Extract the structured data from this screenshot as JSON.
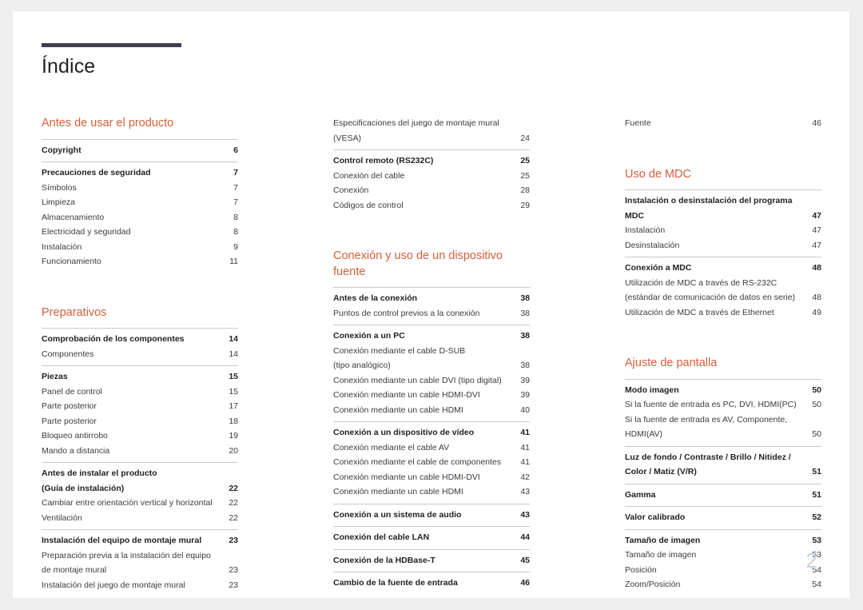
{
  "document": {
    "title": "Índice",
    "folio": "2",
    "accent_color": "#d2603c",
    "rule_color": "#403e4c",
    "folio_color": "#c3d3dd"
  },
  "columns": [
    {
      "name": "column-left",
      "blocks": [
        {
          "type": "section",
          "heading": "Antes de usar el producto",
          "groups": [
            {
              "entries": [
                {
                  "label": "Copyright",
                  "page": "6",
                  "bold": true
                }
              ]
            },
            {
              "entries": [
                {
                  "label": "Precauciones de seguridad",
                  "page": "7",
                  "bold": true
                },
                {
                  "label": "Símbolos",
                  "page": "7",
                  "bold": false
                },
                {
                  "label": "Limpieza",
                  "page": "7",
                  "bold": false
                },
                {
                  "label": "Almacenamiento",
                  "page": "8",
                  "bold": false
                },
                {
                  "label": "Electricidad y seguridad",
                  "page": "8",
                  "bold": false
                },
                {
                  "label": "Instalación",
                  "page": "9",
                  "bold": false
                },
                {
                  "label": "Funcionamiento",
                  "page": "11",
                  "bold": false
                }
              ]
            }
          ]
        },
        {
          "type": "section",
          "heading": "Preparativos",
          "groups": [
            {
              "entries": [
                {
                  "label": "Comprobación de los componentes",
                  "page": "14",
                  "bold": true
                },
                {
                  "label": "Componentes",
                  "page": "14",
                  "bold": false
                }
              ]
            },
            {
              "entries": [
                {
                  "label": "Piezas",
                  "page": "15",
                  "bold": true
                },
                {
                  "label": "Panel de control",
                  "page": "15",
                  "bold": false
                },
                {
                  "label": "Parte posterior",
                  "page": "17",
                  "bold": false
                },
                {
                  "label": "Parte posterior",
                  "page": "18",
                  "bold": false
                },
                {
                  "label": "Bloqueo antirrobo",
                  "page": "19",
                  "bold": false
                },
                {
                  "label": "Mando a distancia",
                  "page": "20",
                  "bold": false
                }
              ]
            },
            {
              "entries": [
                {
                  "label": "Antes de instalar el producto",
                  "page": "",
                  "bold": true,
                  "blank": true
                },
                {
                  "label": "(Guía de instalación)",
                  "page": "22",
                  "bold": true
                },
                {
                  "label": "Cambiar entre orientación vertical y horizontal",
                  "page": "22",
                  "bold": false
                },
                {
                  "label": "Ventilación",
                  "page": "22",
                  "bold": false
                }
              ]
            },
            {
              "entries": [
                {
                  "label": "Instalación del equipo de montaje mural",
                  "page": "23",
                  "bold": true
                },
                {
                  "label": "Preparación previa a la instalación del equipo",
                  "page": "",
                  "bold": false,
                  "blank": true
                },
                {
                  "label": "de montaje mural",
                  "page": "23",
                  "bold": false
                },
                {
                  "label": "Instalación del juego de montaje mural",
                  "page": "23",
                  "bold": false
                }
              ]
            }
          ]
        }
      ]
    },
    {
      "name": "column-middle",
      "blocks": [
        {
          "type": "continuation",
          "groups": [
            {
              "nohead": true,
              "entries": [
                {
                  "label": "Especificaciones del juego de montaje mural",
                  "page": "",
                  "bold": false,
                  "blank": true
                },
                {
                  "label": "(VESA)",
                  "page": "24",
                  "bold": false
                }
              ]
            },
            {
              "entries": [
                {
                  "label": "Control remoto (RS232C)",
                  "page": "25",
                  "bold": true
                },
                {
                  "label": "Conexión del cable",
                  "page": "25",
                  "bold": false
                },
                {
                  "label": "Conexión",
                  "page": "28",
                  "bold": false
                },
                {
                  "label": "Códigos de control",
                  "page": "29",
                  "bold": false
                }
              ]
            }
          ]
        },
        {
          "type": "section",
          "heading": "Conexión y uso de un dispositivo fuente",
          "groups": [
            {
              "entries": [
                {
                  "label": "Antes de la conexión",
                  "page": "38",
                  "bold": true
                },
                {
                  "label": "Puntos de control previos a la conexión",
                  "page": "38",
                  "bold": false
                }
              ]
            },
            {
              "entries": [
                {
                  "label": "Conexión a un PC",
                  "page": "38",
                  "bold": true
                },
                {
                  "label": "Conexión mediante el cable D-SUB",
                  "page": "",
                  "bold": false,
                  "blank": true
                },
                {
                  "label": "(tipo analógico)",
                  "page": "38",
                  "bold": false
                },
                {
                  "label": "Conexión mediante un cable DVI (tipo digital)",
                  "page": "39",
                  "bold": false
                },
                {
                  "label": "Conexión mediante un cable HDMI-DVI",
                  "page": "39",
                  "bold": false
                },
                {
                  "label": "Conexión mediante un cable HDMI",
                  "page": "40",
                  "bold": false
                }
              ]
            },
            {
              "entries": [
                {
                  "label": "Conexión a un dispositivo de vídeo",
                  "page": "41",
                  "bold": true
                },
                {
                  "label": "Conexión mediante el cable AV",
                  "page": "41",
                  "bold": false
                },
                {
                  "label": "Conexión mediante el cable de componentes",
                  "page": "41",
                  "bold": false
                },
                {
                  "label": "Conexión mediante un cable HDMI-DVI",
                  "page": "42",
                  "bold": false
                },
                {
                  "label": "Conexión mediante un cable HDMI",
                  "page": "43",
                  "bold": false
                }
              ]
            },
            {
              "entries": [
                {
                  "label": "Conexión a un sistema de audio",
                  "page": "43",
                  "bold": true
                }
              ]
            },
            {
              "entries": [
                {
                  "label": "Conexión del cable LAN",
                  "page": "44",
                  "bold": true
                }
              ]
            },
            {
              "entries": [
                {
                  "label": "Conexión de la HDBase-T",
                  "page": "45",
                  "bold": true
                }
              ]
            },
            {
              "entries": [
                {
                  "label": "Cambio de la fuente de entrada",
                  "page": "46",
                  "bold": true
                }
              ]
            }
          ]
        }
      ]
    },
    {
      "name": "column-right",
      "blocks": [
        {
          "type": "continuation",
          "groups": [
            {
              "nohead": true,
              "entries": [
                {
                  "label": "Fuente",
                  "page": "46",
                  "bold": false
                }
              ]
            }
          ]
        },
        {
          "type": "section",
          "heading": "Uso de MDC",
          "groups": [
            {
              "entries": [
                {
                  "label": "Instalación o desinstalación del programa",
                  "page": "",
                  "bold": true,
                  "blank": true
                },
                {
                  "label": "MDC",
                  "page": "47",
                  "bold": true
                },
                {
                  "label": "Instalación",
                  "page": "47",
                  "bold": false
                },
                {
                  "label": "Desinstalación",
                  "page": "47",
                  "bold": false
                }
              ]
            },
            {
              "entries": [
                {
                  "label": "Conexión a MDC",
                  "page": "48",
                  "bold": true
                },
                {
                  "label": "Utilización de MDC a través de RS-232C",
                  "page": "",
                  "bold": false,
                  "blank": true
                },
                {
                  "label": "(estándar de comunicación de datos en serie)",
                  "page": "48",
                  "bold": false
                },
                {
                  "label": "Utilización de MDC a través de Ethernet",
                  "page": "49",
                  "bold": false
                }
              ]
            }
          ]
        },
        {
          "type": "section",
          "heading": "Ajuste de pantalla",
          "groups": [
            {
              "entries": [
                {
                  "label": "Modo imagen",
                  "page": "50",
                  "bold": true
                },
                {
                  "label": "Si la fuente de entrada es PC, DVI, HDMI(PC)",
                  "page": "50",
                  "bold": false
                },
                {
                  "label": "Si la fuente de entrada es AV, Componente,",
                  "page": "",
                  "bold": false,
                  "blank": true
                },
                {
                  "label": "HDMI(AV)",
                  "page": "50",
                  "bold": false
                }
              ]
            },
            {
              "entries": [
                {
                  "label": "Luz de fondo / Contraste / Brillo / Nitidez /",
                  "page": "",
                  "bold": true,
                  "blank": true
                },
                {
                  "label": "Color / Matiz (V/R)",
                  "page": "51",
                  "bold": true
                }
              ]
            },
            {
              "entries": [
                {
                  "label": "Gamma",
                  "page": "51",
                  "bold": true
                }
              ]
            },
            {
              "entries": [
                {
                  "label": "Valor calibrado",
                  "page": "52",
                  "bold": true
                }
              ]
            },
            {
              "entries": [
                {
                  "label": "Tamaño de imagen",
                  "page": "53",
                  "bold": true
                },
                {
                  "label": "Tamaño de imagen",
                  "page": "53",
                  "bold": false
                },
                {
                  "label": "Posición",
                  "page": "54",
                  "bold": false
                },
                {
                  "label": "Zoom/Posición",
                  "page": "54",
                  "bold": false
                }
              ]
            }
          ]
        }
      ]
    }
  ]
}
